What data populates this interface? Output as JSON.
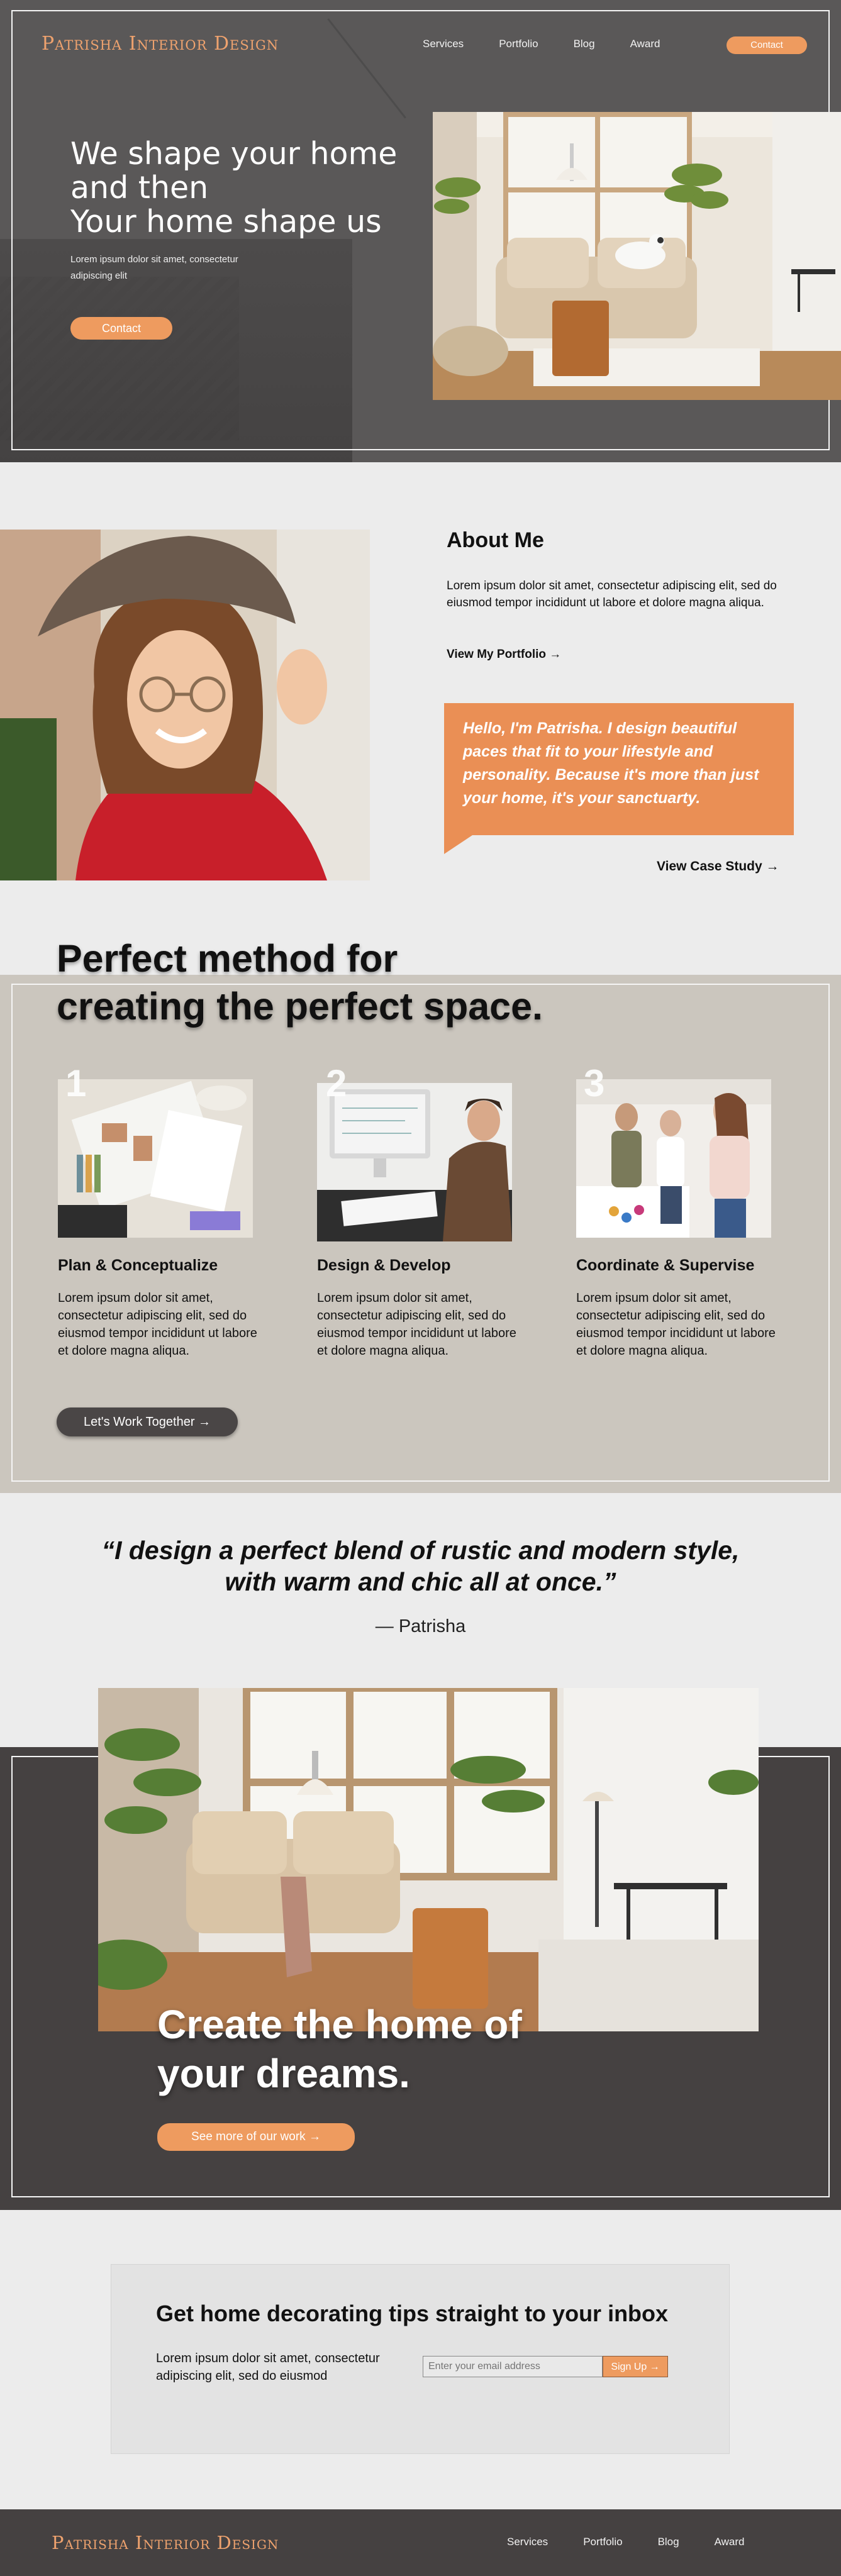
{
  "brand": {
    "logo": "Patrisha Interior Design",
    "accent": "#ee9b5f",
    "dark": "#454141"
  },
  "nav": {
    "items": [
      "Services",
      "Portfolio",
      "Blog",
      "Award"
    ],
    "contact": "Contact"
  },
  "hero": {
    "title_line1": "We shape your home",
    "title_line2": "and then",
    "title_line3": "Your home shape us",
    "subtitle": "Lorem ipsum dolor sit amet, consectetur adipiscing elit",
    "button": "Contact"
  },
  "about": {
    "title": "About Me",
    "text": "Lorem ipsum dolor sit amet, consectetur adipiscing elit, sed do eiusmod tempor incididunt ut labore et dolore magna aliqua.",
    "portfolio_link": "View My Portfolio →",
    "callout": "Hello, I'm Patrisha. I design beautiful paces that fit to your lifestyle and personality. Because it's more than just your home, it's your sanctuarty.",
    "case_link": "View Case Study →"
  },
  "method": {
    "title_line1": "Perfect method for",
    "title_line2": "creating the perfect space.",
    "steps": [
      {
        "num": "1",
        "title": "Plan & Conceptualize",
        "text": "Lorem ipsum dolor sit amet, consectetur adipiscing elit, sed do eiusmod tempor incididunt ut labore et dolore magna aliqua."
      },
      {
        "num": "2",
        "title": "Design & Develop",
        "text": "Lorem ipsum dolor sit amet, consectetur adipiscing elit, sed do eiusmod tempor incididunt ut labore et dolore magna aliqua."
      },
      {
        "num": "3",
        "title": "Coordinate & Supervise",
        "text": "Lorem ipsum dolor sit amet, consectetur adipiscing elit, sed do eiusmod tempor incididunt ut labore et dolore magna aliqua."
      }
    ],
    "button": "Let's Work Together →"
  },
  "quote": {
    "text": "“I design a perfect blend of rustic and modern style, with warm and chic all at once.”",
    "author": "— Patrisha"
  },
  "dreams": {
    "title_line1": "Create the home of",
    "title_line2": "your dreams.",
    "button": "See more of our work →"
  },
  "newsletter": {
    "title": "Get home decorating tips straight to your inbox",
    "text": "Lorem ipsum dolor sit amet, consectetur adipiscing elit, sed do eiusmod",
    "email_placeholder": "Enter your email address",
    "button": "Sign Up →"
  },
  "footer": {
    "logo": "Patrisha Interior Design",
    "items": [
      "Services",
      "Portfolio",
      "Blog",
      "Award"
    ]
  }
}
